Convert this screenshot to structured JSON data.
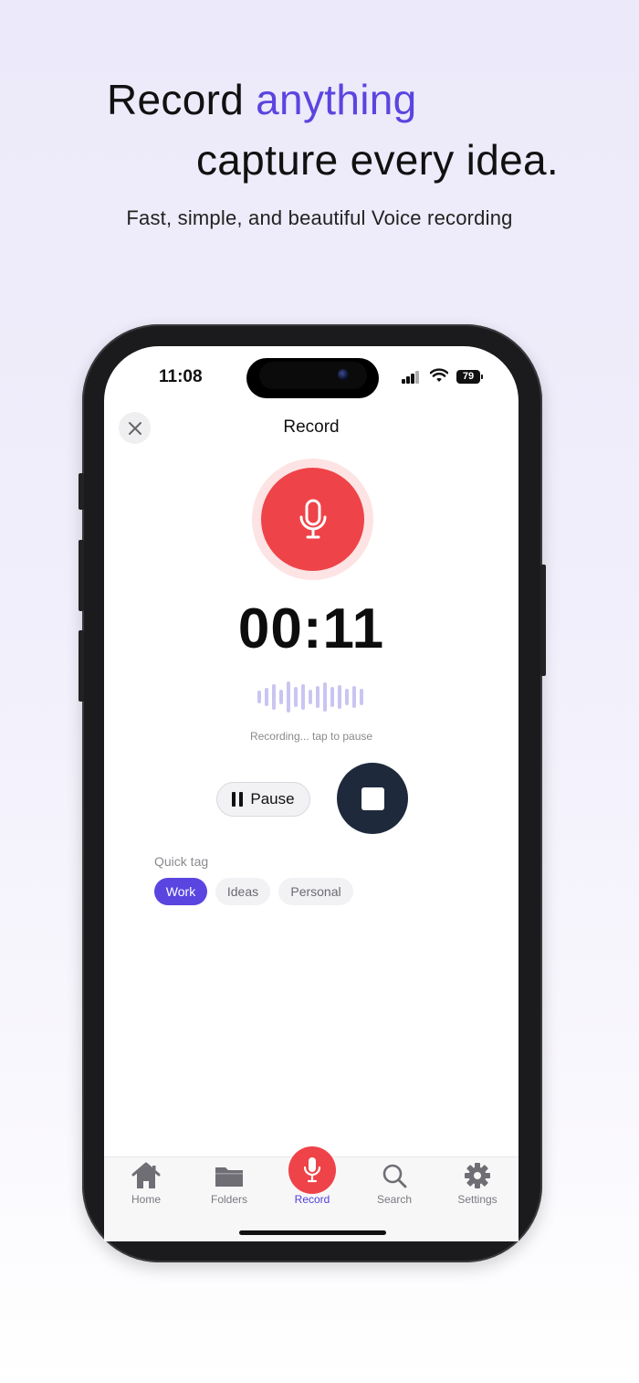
{
  "hero": {
    "line1_prefix": "Record ",
    "line1_accent": "anything",
    "line2": "capture every idea.",
    "subtitle": "Fast, simple, and beautiful Voice recording"
  },
  "status_bar": {
    "time": "11:08",
    "battery": "79"
  },
  "header": {
    "title": "Record",
    "close_icon": "close-icon"
  },
  "recorder": {
    "timer": "00:11",
    "hint": "Recording... tap to pause",
    "pause_label": "Pause",
    "mic_icon": "microphone-icon",
    "stop_icon": "stop-icon"
  },
  "quick_tag": {
    "label": "Quick tag",
    "tags": [
      "Work",
      "Ideas",
      "Personal"
    ],
    "selected": "Work"
  },
  "tabbar": {
    "items": [
      {
        "label": "Home",
        "icon": "home-icon"
      },
      {
        "label": "Folders",
        "icon": "folder-icon"
      },
      {
        "label": "Record",
        "icon": "microphone-icon"
      },
      {
        "label": "Search",
        "icon": "search-icon"
      },
      {
        "label": "Settings",
        "icon": "gear-icon"
      }
    ],
    "active": "Record"
  },
  "colors": {
    "accent": "#5A45E0",
    "record_red": "#EE4348",
    "stop_dark": "#1E293B",
    "wave": "#C9C5F2"
  }
}
